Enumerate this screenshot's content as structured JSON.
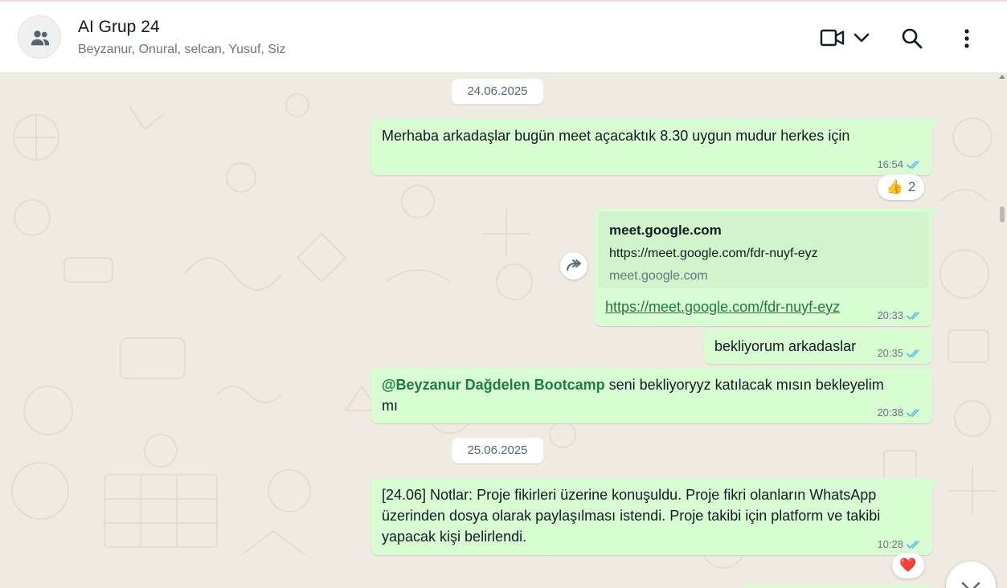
{
  "header": {
    "title": "AI Grup 24",
    "members": "Beyzanur, Onural, selcan, Yusuf, Siz",
    "avatar_icon": "group-icon",
    "actions": [
      "video-call-icon",
      "chevron-down-icon",
      "search-icon",
      "menu-icon"
    ]
  },
  "dates": [
    "24.06.2025",
    "25.06.2025"
  ],
  "messages": [
    {
      "text": "Merhaba arkadaşlar bugün meet açacaktık 8.30 uygun mudur herkes için",
      "time": "16:54",
      "status": "read"
    },
    {
      "link_preview": {
        "title": "meet.google.com",
        "url": "https://meet.google.com/fdr-nuyf-eyz",
        "domain": "meet.google.com"
      },
      "text": "https://meet.google.com/fdr-nuyf-eyz",
      "time": "20:33",
      "status": "read"
    },
    {
      "text": "bekliyorum arkadaslar",
      "time": "20:35",
      "status": "read"
    },
    {
      "mention": "@Beyzanur Dağdelen Bootcamp",
      "text_line1": " seni bekliyoryyz katılacak mısın bekleyelim",
      "text_line2": "mı",
      "time": "20:38",
      "status": "read"
    },
    {
      "lines": [
        "[24.06] Notlar: Proje fikirleri üzerine konuşuldu. Proje fikri olanların WhatsApp",
        "üzerinden dosya olarak paylaşılması istendi. Proje takibi için platform ve takibi",
        "yapacak kişi belirlendi."
      ],
      "time": "10:28",
      "status": "read"
    }
  ],
  "reactions": {
    "first": {
      "emoji": "👍",
      "count": "2"
    },
    "last": {
      "emoji": "❤️"
    }
  },
  "colors": {
    "bubble": "#d9fdd3",
    "chat_bg": "#efeae2",
    "tick": "#53bdeb",
    "mention": "#1f7a44"
  }
}
